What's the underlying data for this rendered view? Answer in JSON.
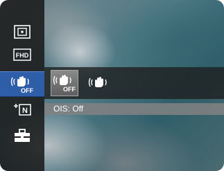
{
  "sidebar": {
    "items": [
      {
        "name": "metering",
        "icon": "spot-metering-icon",
        "label": ""
      },
      {
        "name": "movie-size",
        "icon": "fhd-icon",
        "label": "FHD"
      },
      {
        "name": "ois",
        "icon": "ois-off-icon",
        "label": "OFF",
        "selected": true
      },
      {
        "name": "new-file",
        "icon": "new-file-icon",
        "label": "N"
      },
      {
        "name": "setup",
        "icon": "toolbox-icon",
        "label": ""
      }
    ]
  },
  "options": {
    "items": [
      {
        "name": "ois-off",
        "icon": "ois-off-icon",
        "label": "OFF",
        "selected": true
      },
      {
        "name": "ois-on",
        "icon": "ois-on-icon",
        "label": "",
        "selected": false
      }
    ]
  },
  "status": {
    "text": "OIS: Off"
  },
  "colors": {
    "selected_item": "#2f5ea9",
    "panel": "#191919",
    "info_bar": "#828282"
  }
}
